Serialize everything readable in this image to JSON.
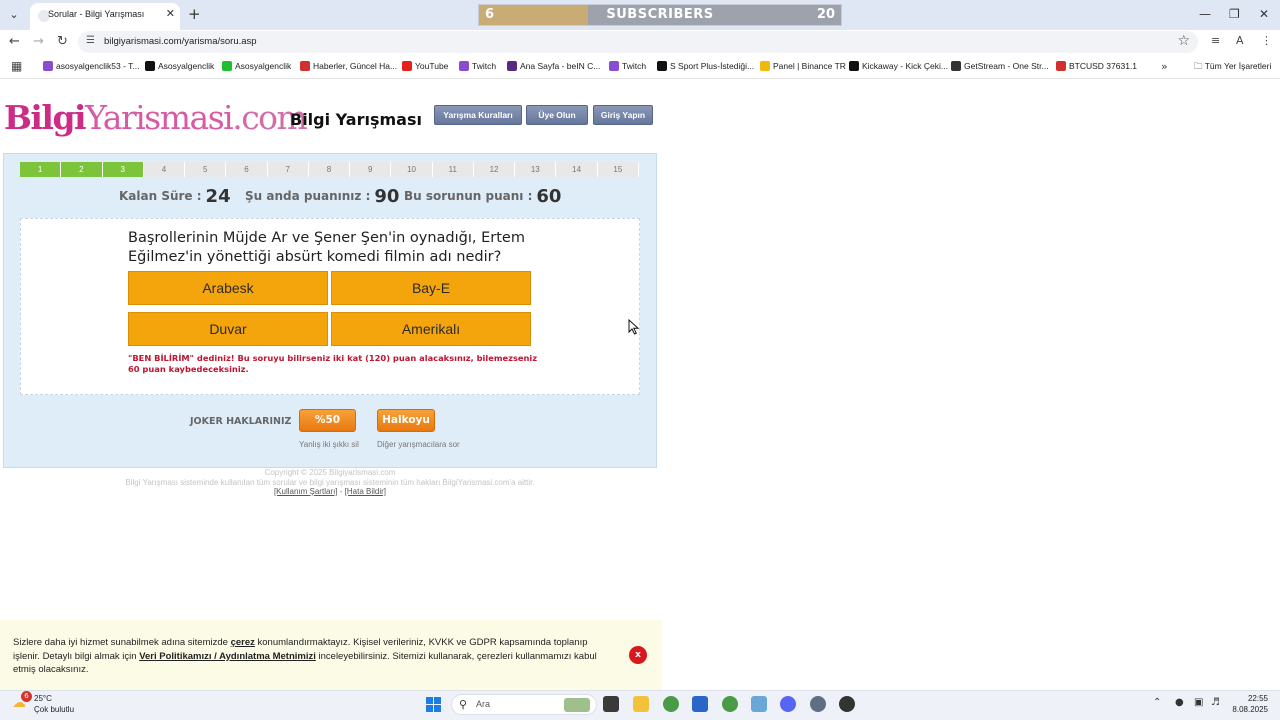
{
  "browser": {
    "tab_title": "Sorular - Bilgi Yarışması",
    "url": "bilgiyarismasi.com/yarisma/soru.asp",
    "subscribers": {
      "current": "6",
      "label": "SUBSCRIBERS",
      "goal": "20",
      "progress": 0.3
    },
    "bookmarks": [
      {
        "label": "asosyalgenclik53 - T...",
        "icon": "twitch-icon",
        "color": "#8b4ccf"
      },
      {
        "label": "Asosyalgenclik",
        "icon": "tiktok-icon",
        "color": "#111111"
      },
      {
        "label": "Asosyalgenclik",
        "icon": "kick-icon",
        "color": "#1fbf2f"
      },
      {
        "label": "Haberler, Güncel Ha...",
        "icon": "news-icon",
        "color": "#d0312d"
      },
      {
        "label": "YouTube",
        "icon": "youtube-icon",
        "color": "#e62117"
      },
      {
        "label": "Twitch",
        "icon": "twitch-icon",
        "color": "#8b4ccf"
      },
      {
        "label": "Ana Sayfa - beIN C...",
        "icon": "bein-icon",
        "color": "#5a2a82"
      },
      {
        "label": "Twitch",
        "icon": "twitch-icon",
        "color": "#8b4ccf"
      },
      {
        "label": "S Sport Plus-İstediği...",
        "icon": "ssport-icon",
        "color": "#111111"
      },
      {
        "label": "Panel | Binance TR",
        "icon": "binance-icon",
        "color": "#f0b90b"
      },
      {
        "label": "Kickaway - Kick Çeki...",
        "icon": "kickaway-icon",
        "color": "#111111"
      },
      {
        "label": "GetStream - One Str...",
        "icon": "getstream-icon",
        "color": "#333333"
      },
      {
        "label": "BTCUSD 37631.1",
        "icon": "btc-icon",
        "color": "#d0312d"
      }
    ],
    "all_bookmarks": "Tüm Yer İşaretleri"
  },
  "site": {
    "logo_part1": "Bilgi",
    "logo_part2": "Yarismasi",
    "logo_part3": ".com",
    "title": "Bilgi Yarışması",
    "nav": {
      "rules": "Yarışma Kuralları",
      "signup": "Üye Olun",
      "login": "Giriş Yapın"
    }
  },
  "quiz": {
    "steps": [
      "1",
      "2",
      "3",
      "4",
      "5",
      "6",
      "7",
      "8",
      "9",
      "10",
      "11",
      "12",
      "13",
      "14",
      "15"
    ],
    "completed_steps": 3,
    "remaining_label": "Kalan Süre :",
    "remaining": "24",
    "score_label": "Şu anda puanınız :",
    "score": "90",
    "question_points_label": "Bu sorunun puanı :",
    "question_points": "60",
    "question": "Başrollerinin Müjde Ar ve Şener Şen'in oynadığı, Ertem Eğilmez'in yönettiği absürt komedi filmin adı nedir?",
    "answers": [
      "Arabesk",
      "Bay-E",
      "Duvar",
      "Amerikalı"
    ],
    "warning": "\"BEN BİLİRİM\" dediniz! Bu soruyu bilirseniz iki kat (120) puan alacaksınız, bilemezseniz 60 puan kaybedeceksiniz.",
    "joker_label": "JOKER HAKLARINIZ",
    "joker_50": "%50",
    "joker_50_desc": "Yanlış iki şıkkı sil",
    "joker_public": "Halkoyu",
    "joker_public_desc": "Diğer yarışmacılara sor"
  },
  "footer": {
    "copyright": "Copyright © 2025 Bilgiyarismasi.com",
    "rights": "Bilgi Yarışması sisteminde kullanılan tüm sorular ve bilgi yarışması sisteminin tüm hakları BilgiYarismasi.com'a aittir.",
    "terms": "[Kullanım Şartları]",
    "separator": "-",
    "report": "[Hata Bildir]"
  },
  "cookie": {
    "text1": "Sizlere daha iyi hizmet sunabilmek adına sitemizde ",
    "link1": "çerez",
    "text2": " konumlandırmaktayız. Kişisel verileriniz, KVKK ve GDPR kapsamında toplanıp işlenir. Detaylı bilgi almak için ",
    "link2": "Veri Politikamızı / Aydınlatma Metnimizi",
    "text3": " inceleyebilirsiniz. Sitemizi kullanarak, çerezleri kullanmamızı kabul etmiş olacaksınız.",
    "close": "x"
  },
  "taskbar": {
    "weather_badge": "6",
    "temp": "25°C",
    "weather": "Çok bulutlu",
    "search": "Ara",
    "time": "22:55",
    "date": "8.08.2025"
  }
}
